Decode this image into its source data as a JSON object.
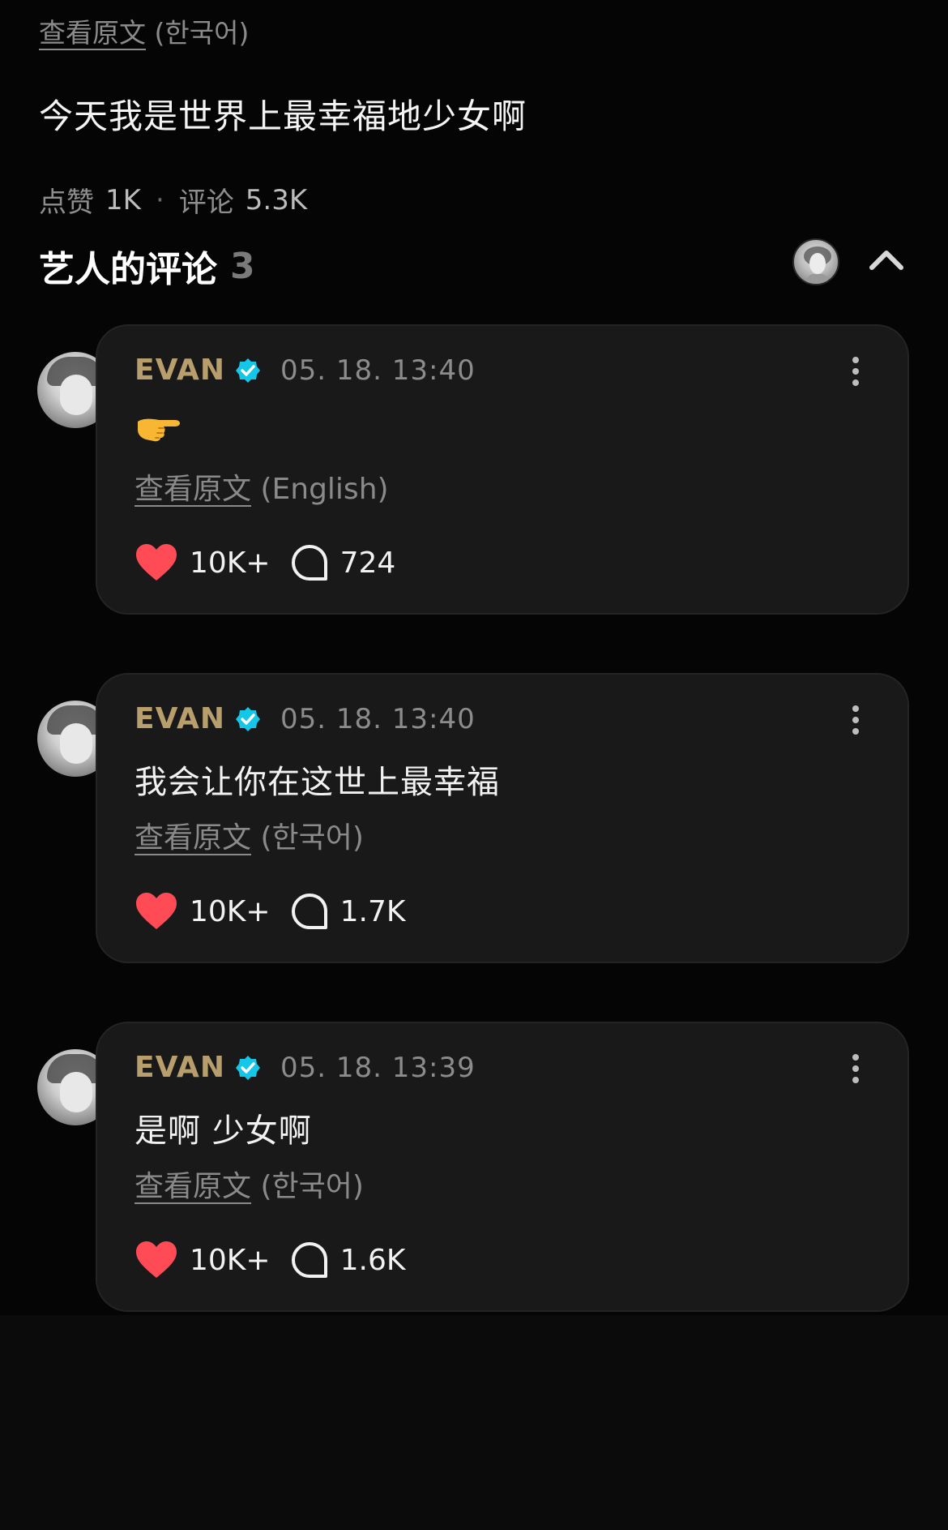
{
  "post": {
    "view_original": "查看原文",
    "view_original_lang": "(한국어)",
    "text": "今天我是世界上最幸福地少女啊",
    "likes_label": "点赞",
    "likes_count": "1K",
    "separator": "·",
    "comments_label": "评论",
    "comments_count": "5.3K"
  },
  "artist_comments": {
    "title": "艺人的评论",
    "count": "3"
  },
  "comments": [
    {
      "author": "EVAN",
      "time": "05. 18. 13:40",
      "text": "",
      "emoji": "pointing-hand-emoji",
      "view_original": "查看原文",
      "view_original_lang": "(English)",
      "likes": "10K+",
      "replies": "724"
    },
    {
      "author": "EVAN",
      "time": "05. 18. 13:40",
      "text": "我会让你在这世上最幸福",
      "view_original": "查看原文",
      "view_original_lang": "(한국어)",
      "likes": "10K+",
      "replies": "1.7K"
    },
    {
      "author": "EVAN",
      "time": "05. 18. 13:39",
      "text": "是啊 少女啊",
      "view_original": "查看原文",
      "view_original_lang": "(한국어)",
      "likes": "10K+",
      "replies": "1.6K"
    }
  ],
  "colors": {
    "author_gold": "#b79e6c",
    "verified_cyan": "#14c6e8",
    "heart_red": "#ff4b55",
    "card_bg": "#191919"
  }
}
